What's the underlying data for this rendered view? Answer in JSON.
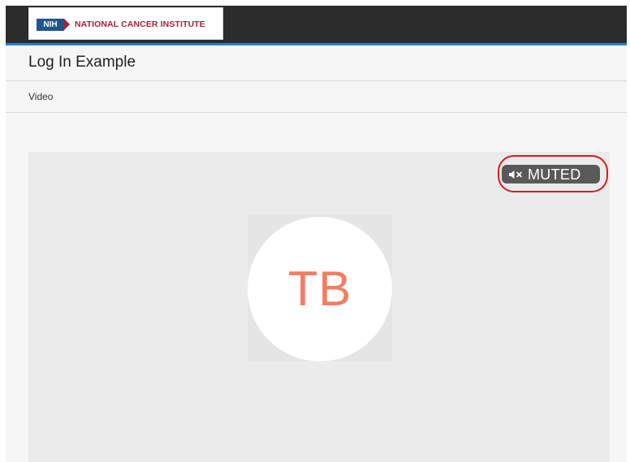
{
  "brand": {
    "logo_abbrev": "NIH",
    "logo_name": "NATIONAL CANCER INSTITUTE"
  },
  "page": {
    "title": "Log In Example"
  },
  "breadcrumb": {
    "current": "Video"
  },
  "video": {
    "status_label": "MUTED",
    "status_icon": "speaker-muted-icon",
    "avatar_initials": "TB"
  },
  "colors": {
    "topbar": "#2c2c2c",
    "accent_line": "#2a7fc8",
    "logo_blue": "#20558a",
    "logo_red": "#a52238",
    "avatar_text": "#f47c61",
    "highlight_ring": "#d71d1d"
  }
}
